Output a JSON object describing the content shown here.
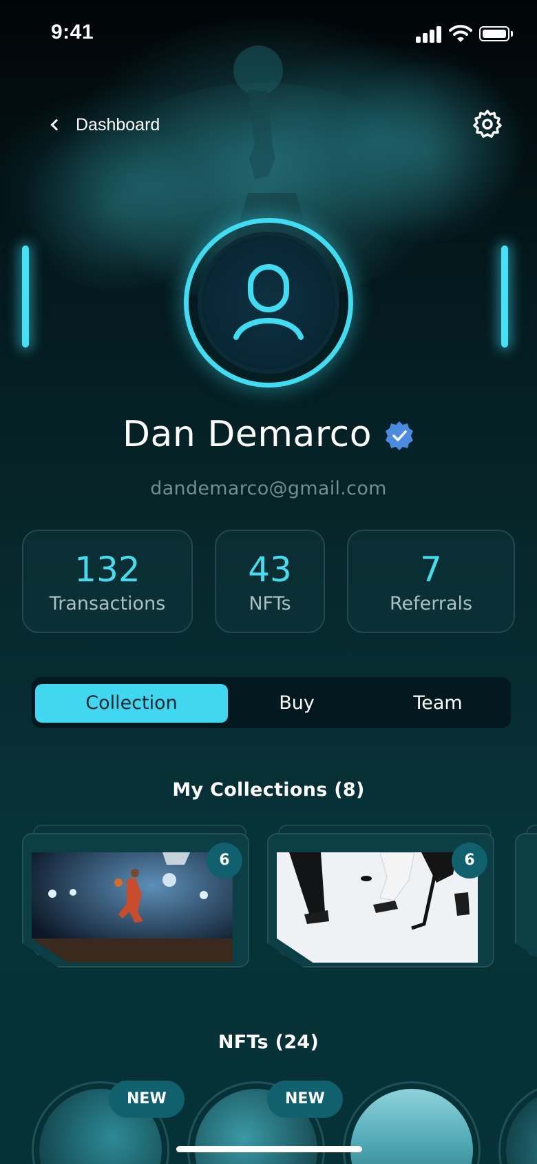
{
  "status_bar": {
    "time": "9:41"
  },
  "header": {
    "back_label": "Dashboard"
  },
  "profile": {
    "name": "Dan Demarco",
    "email": "dandemarco@gmail.com"
  },
  "stats": [
    {
      "value": "132",
      "label": "Transactions"
    },
    {
      "value": "43",
      "label": "NFTs"
    },
    {
      "value": "7",
      "label": "Referrals"
    }
  ],
  "tabs": [
    {
      "label": "Collection",
      "active": true
    },
    {
      "label": "Buy",
      "active": false
    },
    {
      "label": "Team",
      "active": false
    }
  ],
  "collections": {
    "title": "My Collections (8)",
    "cards": [
      {
        "count": "6",
        "subject": "basketball-dunk"
      },
      {
        "count": "6",
        "subject": "ice-hockey"
      }
    ]
  },
  "nfts": {
    "title": "NFTs (24)",
    "new_label": "NEW"
  },
  "colors": {
    "accent": "#41d7f0",
    "badge": "#10606e",
    "verified": "#4c8ce0"
  }
}
